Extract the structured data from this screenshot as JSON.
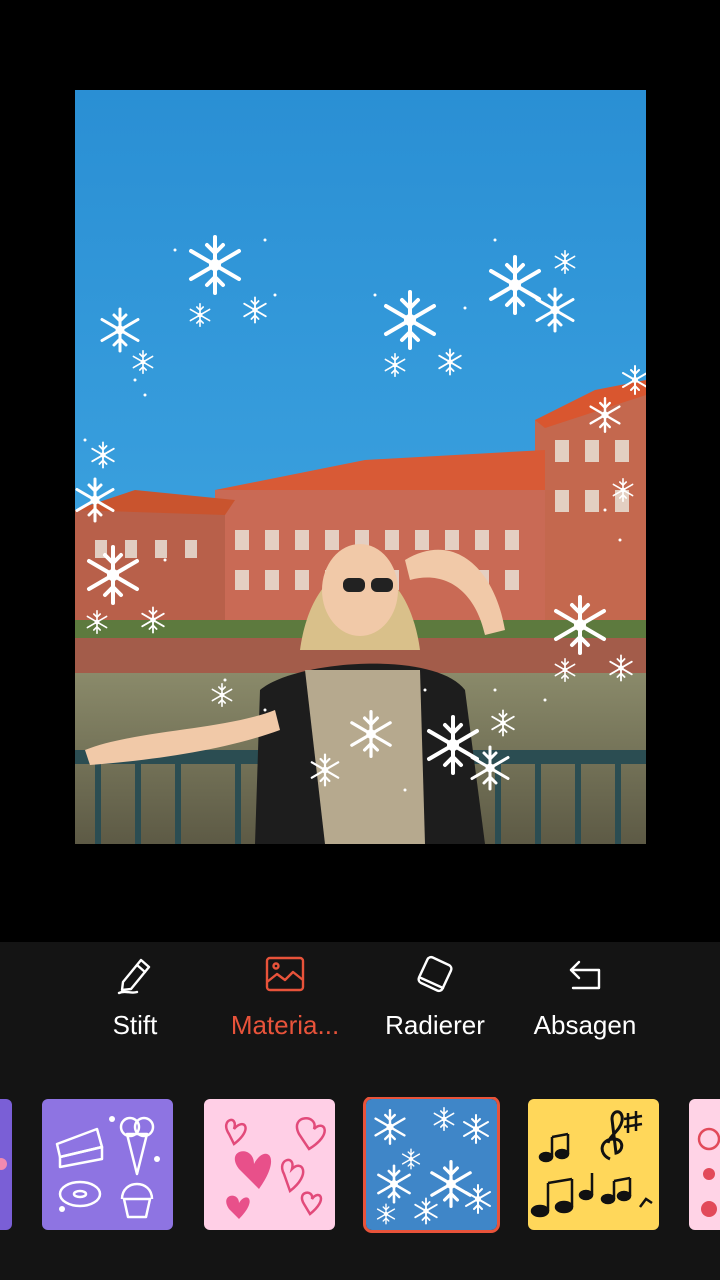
{
  "tools": [
    {
      "label": "Stift",
      "icon": "pen-icon",
      "active": false
    },
    {
      "label": "Materia...",
      "icon": "image-icon",
      "active": true
    },
    {
      "label": "Radierer",
      "icon": "eraser-icon",
      "active": false
    },
    {
      "label": "Absagen",
      "icon": "undo-icon",
      "active": false
    }
  ],
  "materials": [
    {
      "name": "partial-purple",
      "background": "#7a5fd6"
    },
    {
      "name": "sweets",
      "background": "#8e74e2"
    },
    {
      "name": "hearts",
      "background": "#ffcfe6"
    },
    {
      "name": "snowflakes",
      "background": "#3f86c8",
      "selected": true
    },
    {
      "name": "music-notes",
      "background": "#ffd75a"
    },
    {
      "name": "partial-pink",
      "background": "#ffd3e6"
    }
  ],
  "colors": {
    "accent": "#e8533a",
    "toolbar_bg": "#141414"
  }
}
